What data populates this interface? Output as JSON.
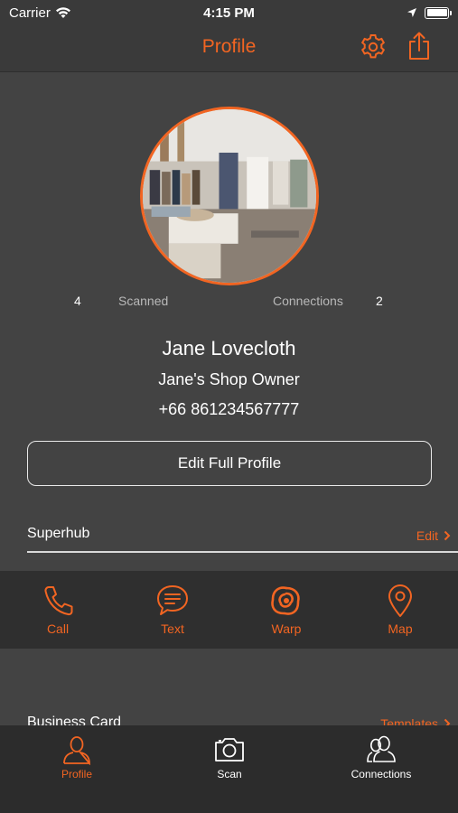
{
  "status_bar": {
    "carrier": "Carrier",
    "time": "4:15 PM",
    "icons": [
      "wifi-icon",
      "location-arrow-icon",
      "battery-icon"
    ]
  },
  "nav": {
    "title": "Profile",
    "icons": [
      "gear-icon",
      "share-icon"
    ],
    "accent_color": "#f26522"
  },
  "profile": {
    "photo": "store-interior-photo",
    "stats": {
      "scanned_count": "4",
      "scanned_label": "Scanned",
      "connections_label": "Connections",
      "connections_count": "2"
    },
    "name": "Jane Lovecloth",
    "role": "Jane's Shop Owner",
    "phone": "+66 861234567777",
    "edit_button_label": "Edit Full Profile"
  },
  "superhub": {
    "title": "Superhub",
    "action_label": "Edit"
  },
  "actions": [
    {
      "label": "Call",
      "icon": "phone-icon"
    },
    {
      "label": "Text",
      "icon": "chat-bubble-icon"
    },
    {
      "label": "Warp",
      "icon": "warp-swirl-icon"
    },
    {
      "label": "Map",
      "icon": "map-pin-icon"
    }
  ],
  "business_card": {
    "title": "Business Card",
    "action_label": "Templates"
  },
  "tabs": [
    {
      "label": "Profile",
      "icon": "person-icon",
      "active": true
    },
    {
      "label": "Scan",
      "icon": "camera-icon",
      "active": false
    },
    {
      "label": "Connections",
      "icon": "people-icon",
      "active": false
    }
  ],
  "colors": {
    "accent": "#f26522",
    "background": "#434343",
    "bar_background": "#2f2f2f"
  }
}
